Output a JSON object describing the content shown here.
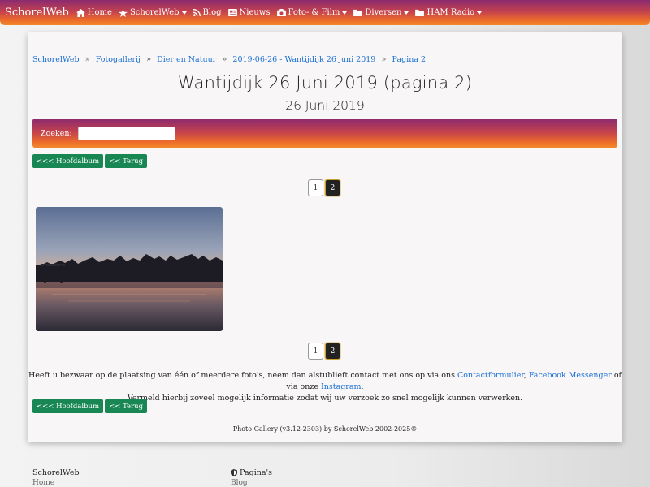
{
  "navbar": {
    "brand": "SchorelWeb",
    "items": [
      {
        "label": "Home",
        "icon": "home-icon",
        "dropdown": false
      },
      {
        "label": "SchorelWeb",
        "icon": "star-icon",
        "dropdown": true
      },
      {
        "label": "Blog",
        "icon": "rss-icon",
        "dropdown": false
      },
      {
        "label": "Nieuws",
        "icon": "newspaper-icon",
        "dropdown": false
      },
      {
        "label": "Foto- & Film",
        "icon": "camera-icon",
        "dropdown": true
      },
      {
        "label": "Diversen",
        "icon": "folder-icon",
        "dropdown": true
      },
      {
        "label": "HAM Radio",
        "icon": "folder-icon",
        "dropdown": true
      }
    ]
  },
  "breadcrumb": [
    "SchorelWeb",
    "Fotogallerij",
    "Dier en Natuur",
    "2019-06-26 - Wantijdijk 26 juni 2019",
    "Pagina 2"
  ],
  "breadcrumb_sep": "»",
  "title": "Wantijdijk 26 Juni 2019 (pagina 2)",
  "subtitle": "26 Juni 2019",
  "search": {
    "label": "Zoeken:",
    "value": "",
    "placeholder": ""
  },
  "buttons": {
    "main_album": "<<< Hoofdalbum",
    "back": "<< Terug"
  },
  "pagination": {
    "pages": [
      "1",
      "2"
    ],
    "active": "2"
  },
  "notice": {
    "text_before": "Heeft u bezwaar op de plaatsing van één of meerdere foto's, neem dan alstublieft contact met ons op via ons ",
    "link_contact": "Contactformulier",
    "sep1": ", ",
    "link_messenger": "Facebook Messenger",
    "text_mid": " of via onze ",
    "link_instagram": "Instagram",
    "text_end": ".",
    "line2": "Vermeld hierbij zoveel mogelijk informatie zodat wij uw verzoek zo snel mogelijk kunnen verwerken."
  },
  "credit": "Photo Gallery (v3.12-2303) by SchorelWeb 2002-2025©",
  "footer": {
    "col1": {
      "title": "SchorelWeb",
      "link": "Home"
    },
    "col2": {
      "title": "Pagina's",
      "icon": "shield-icon",
      "link": "Blog"
    }
  },
  "colors": {
    "accent_green": "#198754",
    "link": "#1a6fd4",
    "gradient_start": "#8a2a6f",
    "gradient_end": "#f3892a"
  }
}
